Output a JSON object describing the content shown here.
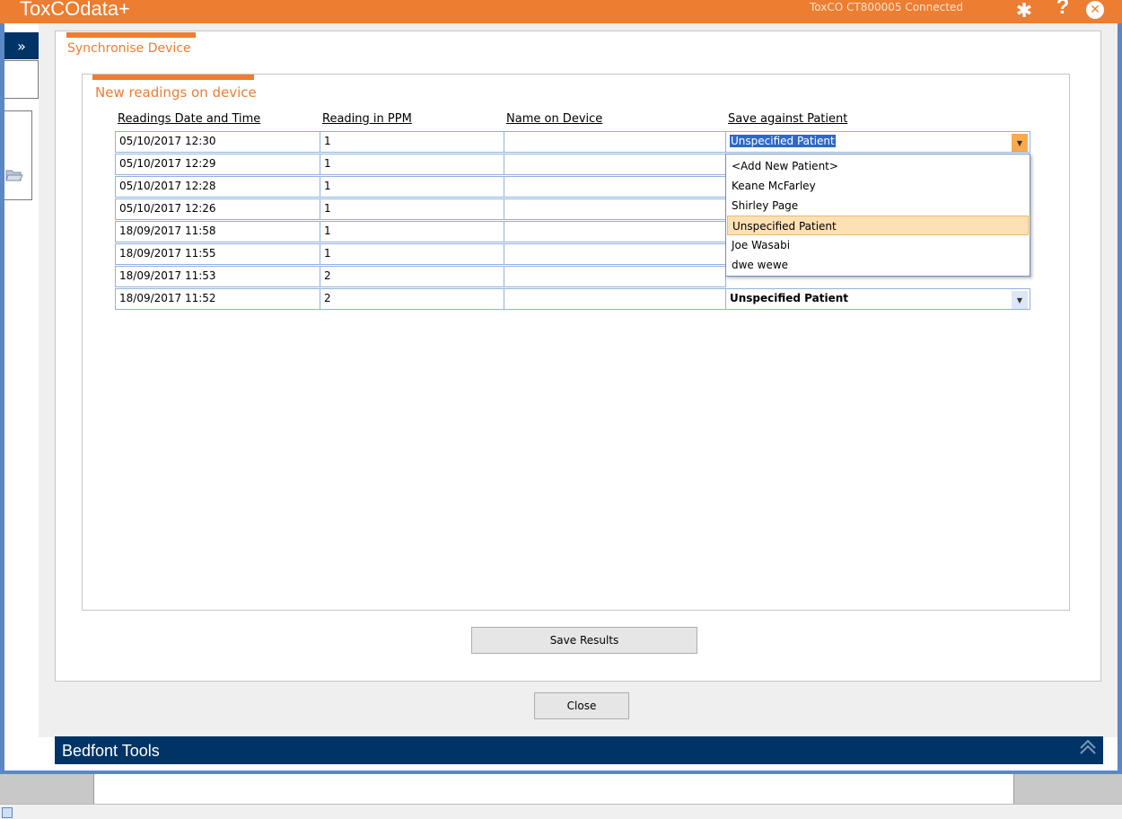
{
  "app": {
    "title": "ToxCOdata+",
    "connection_status": "ToxCO CT800005 Connected"
  },
  "titlebar_icons": [
    "gear-icon",
    "help-icon",
    "close-icon"
  ],
  "sync_panel": {
    "title": "Synchronise Device",
    "section_title": "New readings on device",
    "columns": [
      "Readings Date and Time",
      "Reading in PPM",
      "Name on Device",
      "Save against Patient"
    ],
    "rows": [
      {
        "datetime": "05/10/2017 12:30",
        "ppm": "1",
        "name": "",
        "patient": "Unspecified Patient"
      },
      {
        "datetime": "05/10/2017 12:29",
        "ppm": "1",
        "name": "",
        "patient": ""
      },
      {
        "datetime": "05/10/2017 12:28",
        "ppm": "1",
        "name": "",
        "patient": ""
      },
      {
        "datetime": "05/10/2017 12:26",
        "ppm": "1",
        "name": "",
        "patient": ""
      },
      {
        "datetime": "18/09/2017 11:58",
        "ppm": "1",
        "name": "",
        "patient": ""
      },
      {
        "datetime": "18/09/2017 11:55",
        "ppm": "1",
        "name": "",
        "patient": ""
      },
      {
        "datetime": "18/09/2017 11:53",
        "ppm": "2",
        "name": "",
        "patient": ""
      },
      {
        "datetime": "18/09/2017 11:52",
        "ppm": "2",
        "name": "",
        "patient": "Unspecified Patient"
      }
    ],
    "patient_options": [
      "<Add New Patient>",
      "Keane McFarley",
      "Shirley Page",
      "Unspecified Patient",
      "Joe Wasabi",
      "dwe wewe"
    ],
    "selected_option": "Unspecified Patient",
    "save_button": "Save Results"
  },
  "close_button": "Close",
  "bedfont_tools": {
    "label": "Bedfont Tools"
  },
  "colors": {
    "accent": "#ed7d31",
    "navy": "#003466",
    "frame": "#5b87c5"
  }
}
